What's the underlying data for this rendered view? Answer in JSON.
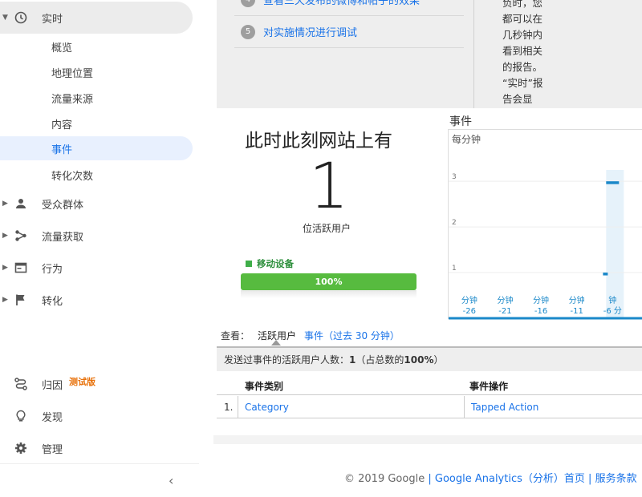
{
  "sidebar": {
    "realtime": "实时",
    "sub_items": [
      "概览",
      "地理位置",
      "流量来源",
      "内容",
      "事件",
      "转化次数"
    ],
    "sections": [
      "受众群体",
      "流量获取",
      "行为",
      "转化"
    ],
    "bottom": {
      "attribution": "归因",
      "beta": "测试版",
      "discover": "发现",
      "admin": "管理"
    },
    "collapse_icon": "chevron-left-icon"
  },
  "setup": {
    "step4_text": "查看三天发布的微博和帖子的效果",
    "step5_num": "5",
    "step5_text": "对实施情况进行调试",
    "note": "负时，您\n都可以在\n几秒钟内\n看到相关\n的报告。\n“实时”报\n告会显"
  },
  "active_users": {
    "title": "此时此刻网站上有",
    "count": "1",
    "subtitle": "位活跃用户",
    "device_label": "移动设备",
    "device_percent": "100%",
    "device_share": 1.0
  },
  "chart_data": {
    "type": "bar",
    "title": "事件",
    "subtitle": "每分钟",
    "x_unit": "分钟",
    "categories": [
      "-26",
      "-21",
      "-16",
      "-11",
      "-6"
    ],
    "tick_labels": [
      {
        "label": "分钟",
        "value": "-26"
      },
      {
        "label": "分钟",
        "value": "-21"
      },
      {
        "label": "分钟",
        "value": "-16"
      },
      {
        "label": "分钟",
        "value": "-11"
      },
      {
        "label": "钟",
        "value": "-6 分"
      }
    ],
    "yticks": [
      1,
      2,
      3
    ],
    "ylim": [
      0,
      3.6
    ],
    "bars": [
      {
        "minute": -7,
        "value": 1
      },
      {
        "minute": -6,
        "value": 3
      }
    ],
    "colors": {
      "bar": "#1a88c9",
      "highlight": "#e6f2fa",
      "axis": "#1a88c9"
    }
  },
  "table": {
    "view_label": "查看：",
    "tabs": [
      "活跃用户",
      "事件（过去 30 分钟）"
    ],
    "summary_prefix": "发送过事件的活跃用户人数：",
    "summary_value": "1",
    "summary_suffix": "（占总数的",
    "summary_percent": "100%",
    "summary_end": "）",
    "headers": [
      "事件类别",
      "事件操作"
    ],
    "rows": [
      {
        "index": "1.",
        "category": "Category",
        "action": "Tapped Action"
      }
    ]
  },
  "footer": {
    "copyright": "© 2019 Google",
    "sep": "|",
    "home": "Google Analytics（分析）首页",
    "terms": "服务条款"
  }
}
